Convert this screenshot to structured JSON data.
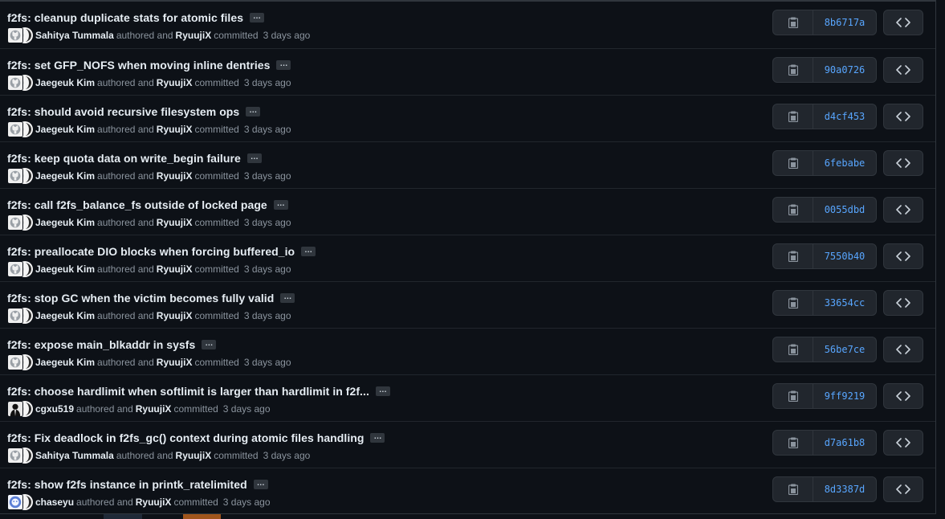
{
  "labels": {
    "authored": "authored and",
    "committed": "committed",
    "ellipsis": "…"
  },
  "colors": {
    "background": "#0d1117",
    "title_text": "#e6edf3",
    "muted_text": "#8b949e",
    "sha_link": "#58a6ff",
    "button_bg": "#21262d",
    "border": "#30363d"
  },
  "icons": {
    "ellipsis": "kebab-horizontal-icon",
    "copy": "clipboard-copy-icon",
    "browse": "code-brackets-icon",
    "avatar_default": "github-default-avatar-icon"
  },
  "commits": [
    {
      "title": "f2fs: cleanup duplicate stats for atomic files",
      "author": "Sahitya Tummala",
      "author_avatar": "default",
      "committer": "RyuujiX",
      "time": "3 days ago",
      "sha": "8b6717a"
    },
    {
      "title": "f2fs: set GFP_NOFS when moving inline dentries",
      "author": "Jaegeuk Kim",
      "author_avatar": "default",
      "committer": "RyuujiX",
      "time": "3 days ago",
      "sha": "90a0726"
    },
    {
      "title": "f2fs: should avoid recursive filesystem ops",
      "author": "Jaegeuk Kim",
      "author_avatar": "default",
      "committer": "RyuujiX",
      "time": "3 days ago",
      "sha": "d4cf453"
    },
    {
      "title": "f2fs: keep quota data on write_begin failure",
      "author": "Jaegeuk Kim",
      "author_avatar": "default",
      "committer": "RyuujiX",
      "time": "3 days ago",
      "sha": "6febabe"
    },
    {
      "title": "f2fs: call f2fs_balance_fs outside of locked page",
      "author": "Jaegeuk Kim",
      "author_avatar": "default",
      "committer": "RyuujiX",
      "time": "3 days ago",
      "sha": "0055dbd"
    },
    {
      "title": "f2fs: preallocate DIO blocks when forcing buffered_io",
      "author": "Jaegeuk Kim",
      "author_avatar": "default",
      "committer": "RyuujiX",
      "time": "3 days ago",
      "sha": "7550b40"
    },
    {
      "title": "f2fs: stop GC when the victim becomes fully valid",
      "author": "Jaegeuk Kim",
      "author_avatar": "default",
      "committer": "RyuujiX",
      "time": "3 days ago",
      "sha": "33654cc"
    },
    {
      "title": "f2fs: expose main_blkaddr in sysfs",
      "author": "Jaegeuk Kim",
      "author_avatar": "default",
      "committer": "RyuujiX",
      "time": "3 days ago",
      "sha": "56be7ce"
    },
    {
      "title": "f2fs: choose hardlimit when softlimit is larger than hardlimit in f2f...",
      "author": "cgxu519",
      "author_avatar": "photo-bw",
      "committer": "RyuujiX",
      "time": "3 days ago",
      "sha": "9ff9219"
    },
    {
      "title": "f2fs: Fix deadlock in f2fs_gc() context during atomic files handling",
      "author": "Sahitya Tummala",
      "author_avatar": "default",
      "committer": "RyuujiX",
      "time": "3 days ago",
      "sha": "d7a61b8"
    },
    {
      "title": "f2fs: show f2fs instance in printk_ratelimited",
      "author": "chaseyu",
      "author_avatar": "photo-blue",
      "committer": "RyuujiX",
      "time": "3 days ago",
      "sha": "8d3387d"
    }
  ]
}
